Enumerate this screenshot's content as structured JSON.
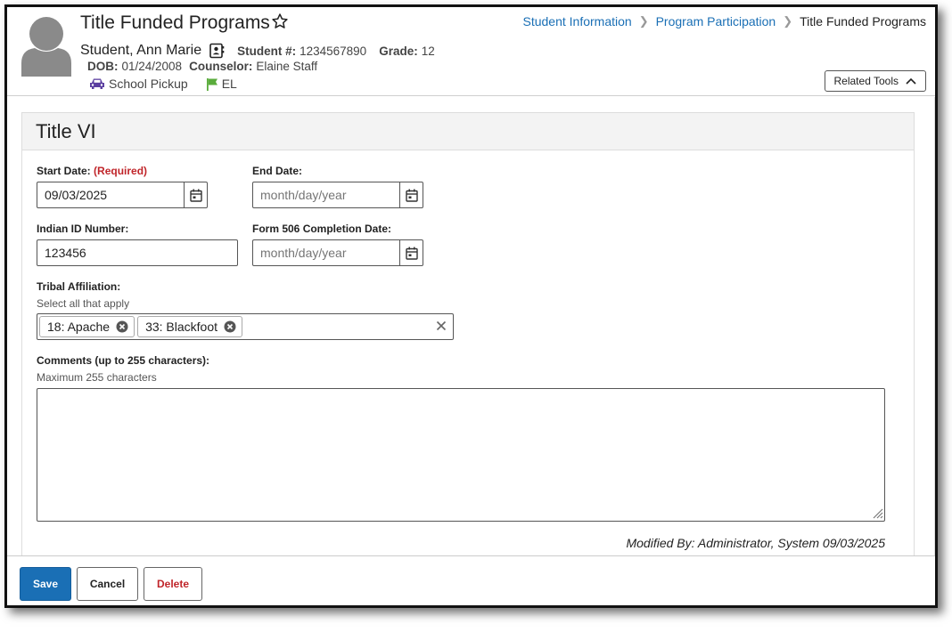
{
  "header": {
    "title": "Title Funded Programs",
    "breadcrumb": [
      "Student Information",
      "Program Participation",
      "Title Funded Programs"
    ],
    "student_name": "Student, Ann Marie",
    "student_num_label": "Student #:",
    "student_num": "1234567890",
    "grade_label": "Grade:",
    "grade": "12",
    "dob_label": "DOB:",
    "dob": "01/24/2008",
    "counselor_label": "Counselor:",
    "counselor": "Elaine Staff",
    "tags": [
      {
        "label": "School Pickup",
        "icon": "car-icon",
        "color": "#5b3fa0"
      },
      {
        "label": "EL",
        "icon": "flag-icon",
        "color": "#5aac3c"
      }
    ],
    "related_tools": "Related Tools"
  },
  "panel": {
    "title": "Title VI",
    "start_date": {
      "label": "Start Date:",
      "required": "(Required)",
      "value": "09/03/2025"
    },
    "end_date": {
      "label": "End Date:",
      "placeholder": "month/day/year"
    },
    "indian_id": {
      "label": "Indian ID Number:",
      "value": "123456"
    },
    "form506": {
      "label": "Form 506 Completion Date:",
      "placeholder": "month/day/year"
    },
    "tribal": {
      "label": "Tribal Affiliation:",
      "hint": "Select all that apply",
      "selected": [
        "18: Apache",
        "33: Blackfoot"
      ]
    },
    "comments": {
      "label": "Comments (up to 255 characters):",
      "hint": "Maximum 255 characters",
      "value": ""
    },
    "modified": "Modified By: Administrator, System 09/03/2025"
  },
  "footer": {
    "save": "Save",
    "cancel": "Cancel",
    "delete": "Delete"
  },
  "colors": {
    "accent": "#1a6fb5",
    "danger": "#c0252a"
  }
}
